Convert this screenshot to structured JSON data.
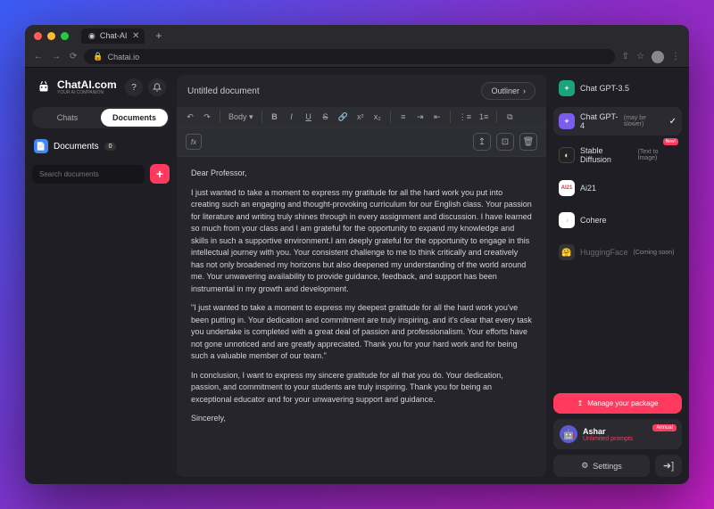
{
  "browser": {
    "tab_title": "Chat-AI",
    "url": "Chatai.io"
  },
  "brand": {
    "name": "ChatAI.com",
    "tagline": "YOUR AI COMPANION"
  },
  "sidebar": {
    "tabs": {
      "chats": "Chats",
      "documents": "Documents"
    },
    "section": {
      "label": "Documents",
      "count": "0"
    },
    "search_placeholder": "Search documents"
  },
  "document": {
    "title": "Untitled document",
    "outliner": "Outliner",
    "body_select": "Body",
    "para1": "Dear Professor,",
    "para2": "I just wanted to take a moment to express my gratitude for all the hard work you put into creating such an engaging and thought-provoking curriculum for our English class. Your passion for literature and writing truly shines through in every assignment and discussion. I have learned so much from your class and I am grateful for the opportunity to expand my knowledge and skills in such a supportive environment.I am deeply grateful for the opportunity to engage in this intellectual journey with you. Your consistent challenge to me to think critically and creatively has not only broadened my horizons but also deepened my understanding of the world around me. Your unwavering availability to provide guidance, feedback, and support has been instrumental in my growth and development.",
    "para3": "\"I just wanted to take a moment to express my deepest gratitude for all the hard work you've been putting in. Your dedication and commitment are truly inspiring, and it's clear that every task you undertake is completed with a great deal of passion and professionalism. Your efforts have not gone unnoticed and are greatly appreciated. Thank you for your hard work and for being such a valuable member of our team.\"",
    "para4": "In conclusion, I want to express my sincere gratitude for all that you do. Your dedication, passion, and commitment to your students are truly inspiring. Thank you for being an exceptional educator and for your unwavering support and guidance.",
    "para5": "Sincerely,"
  },
  "models": {
    "gpt35": "Chat GPT-3.5",
    "gpt4": "Chat GPT-4",
    "gpt4_note": "(may be slower)",
    "sd": "Stable Diffusion",
    "sd_note": "(Text to Image)",
    "sd_badge": "New!",
    "ai21": "Ai21",
    "cohere": "Cohere",
    "hf": "HuggingFace",
    "hf_note": "(Coming soon)"
  },
  "footer": {
    "package": "Manage your package",
    "user_name": "Ashar",
    "user_plan": "Unlimited prompts",
    "user_badge": "Annual",
    "settings": "Settings"
  }
}
